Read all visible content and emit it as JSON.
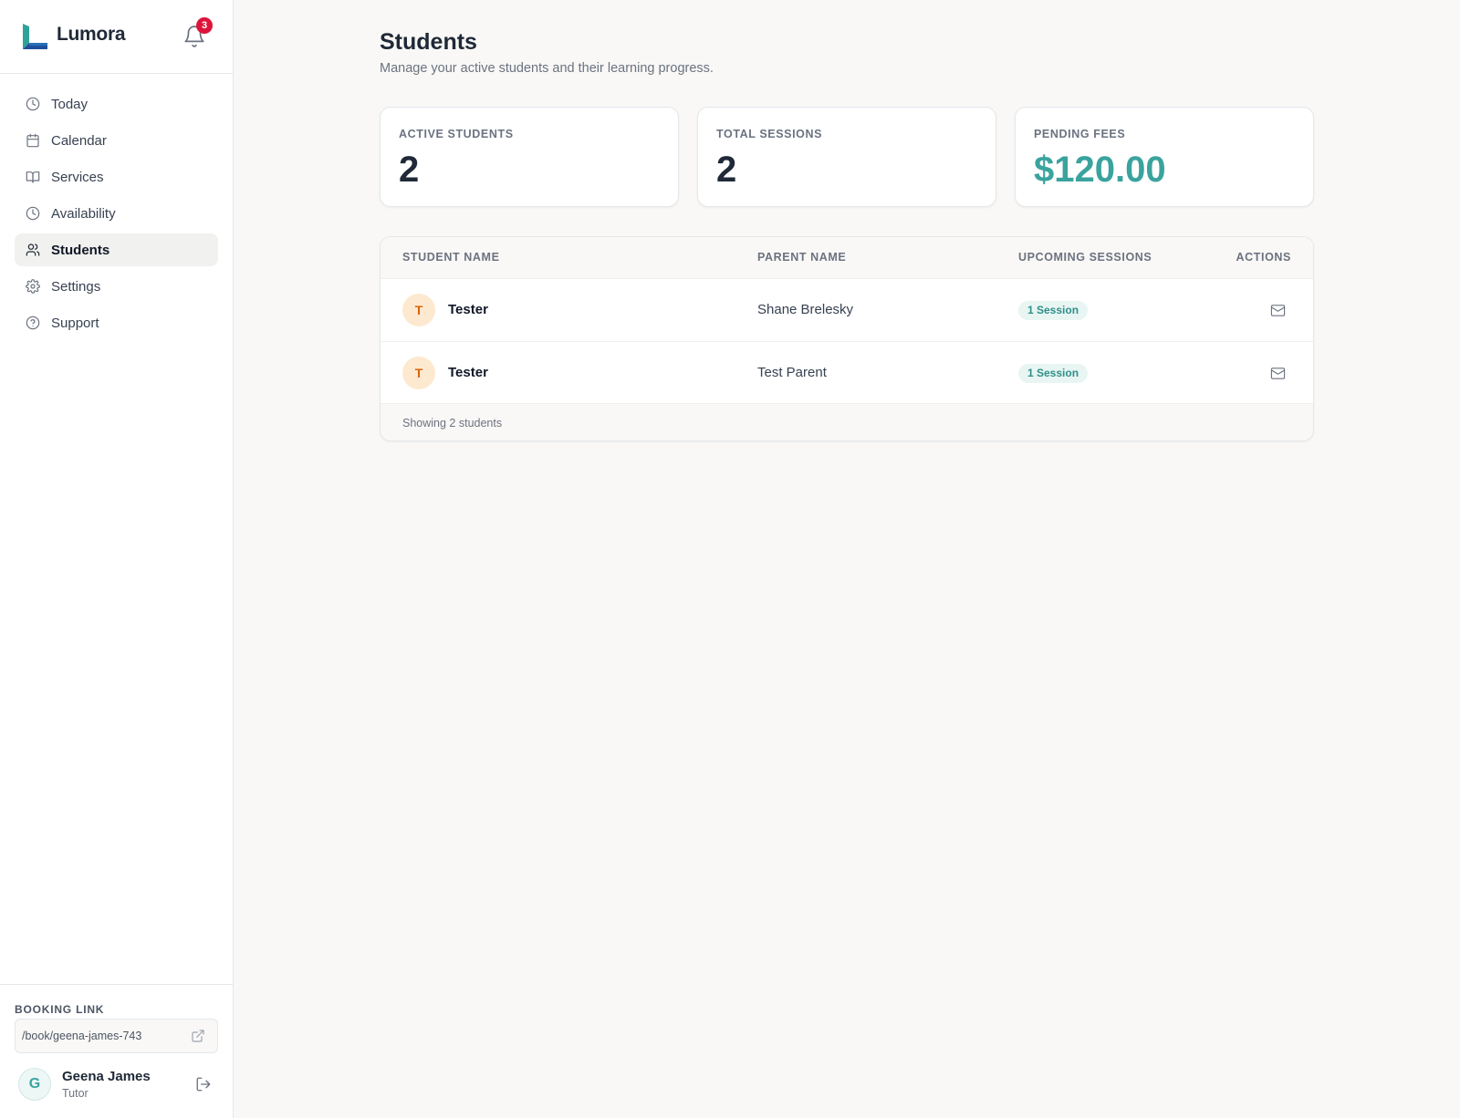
{
  "app": {
    "name": "Lumora",
    "notification_count": "3"
  },
  "sidebar": {
    "items": [
      {
        "label": "Today",
        "icon": "clock-icon"
      },
      {
        "label": "Calendar",
        "icon": "calendar-icon"
      },
      {
        "label": "Services",
        "icon": "book-icon"
      },
      {
        "label": "Availability",
        "icon": "clock-icon"
      },
      {
        "label": "Students",
        "icon": "users-icon",
        "active": true
      },
      {
        "label": "Settings",
        "icon": "gear-icon"
      },
      {
        "label": "Support",
        "icon": "help-circle-icon"
      }
    ],
    "booking": {
      "label": "BOOKING LINK",
      "url": "/book/geena-james-743"
    },
    "user": {
      "initial": "G",
      "name": "Geena James",
      "role": "Tutor"
    }
  },
  "page": {
    "title": "Students",
    "subtitle": "Manage your active students and their learning progress."
  },
  "stats": [
    {
      "label": "ACTIVE STUDENTS",
      "value": "2"
    },
    {
      "label": "TOTAL SESSIONS",
      "value": "2"
    },
    {
      "label": "PENDING FEES",
      "value": "$120.00"
    }
  ],
  "table": {
    "headers": {
      "student": "STUDENT NAME",
      "parent": "PARENT NAME",
      "sessions": "UPCOMING SESSIONS",
      "actions": "ACTIONS"
    },
    "rows": [
      {
        "initial": "T",
        "student": "Tester",
        "parent": "Shane Brelesky",
        "sessions": "1 Session"
      },
      {
        "initial": "T",
        "student": "Tester",
        "parent": "Test Parent",
        "sessions": "1 Session"
      }
    ],
    "footer": "Showing 2 students"
  },
  "colors": {
    "accent": "#3aa39e",
    "badge": "#dc143c",
    "avatar_bg": "#fde9d0",
    "avatar_text": "#d9640a"
  }
}
